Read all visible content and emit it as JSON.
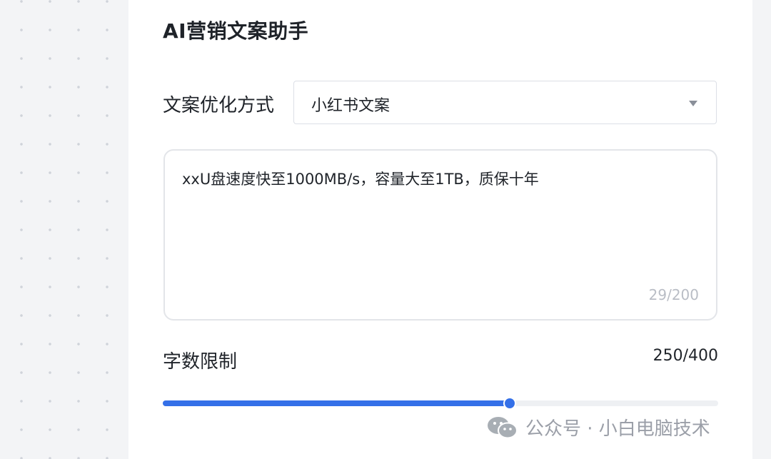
{
  "app": {
    "title": "AI营销文案助手"
  },
  "form": {
    "mode_label": "文案优化方式",
    "mode_value": "小红书文案",
    "input_text": "xxU盘速度快至1000MB/s，容量大至1TB，质保十年",
    "input_count": "29/200",
    "limit_label": "字数限制",
    "limit_value": "250/400",
    "limit_current": 250,
    "limit_max": 400
  },
  "watermark": {
    "text": "公众号 · 小白电脑技术"
  },
  "colors": {
    "accent": "#3470e8",
    "track": "#eef0f3",
    "background": "#f3f4f6"
  },
  "icons": {
    "select_caret": "caret-down-icon",
    "watermark": "wechat-icon"
  }
}
